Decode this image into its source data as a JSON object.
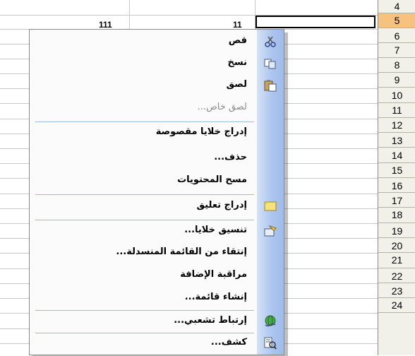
{
  "spreadsheet": {
    "row_numbers": [
      "4",
      "5",
      "6",
      "7",
      "8",
      "9",
      "10",
      "11",
      "12",
      "13",
      "14",
      "15",
      "16",
      "17",
      "18",
      "19",
      "20",
      "21",
      "22",
      "23",
      "24"
    ],
    "active_row": "5",
    "cell_values": [
      "111",
      "11"
    ]
  },
  "context_menu": {
    "items": [
      {
        "label": "قص",
        "enabled": true,
        "icon": "scissors-icon"
      },
      {
        "label": "نسخ",
        "enabled": true,
        "icon": "copy-icon"
      },
      {
        "label": "لصق",
        "enabled": true,
        "icon": "paste-icon"
      },
      {
        "label": "لصق خاص...",
        "enabled": false,
        "icon": ""
      },
      {
        "label": "إدراج خلايا مقصوصة",
        "enabled": true,
        "icon": ""
      },
      {
        "label": "حذف...",
        "enabled": true,
        "icon": ""
      },
      {
        "label": "مسح المحتويات",
        "enabled": true,
        "icon": ""
      },
      {
        "label": "إدراج تعليق",
        "enabled": true,
        "icon": "comment-icon"
      },
      {
        "label": "تنسيق خلايا...",
        "enabled": true,
        "icon": "format-cells-icon"
      },
      {
        "label": "إنتقاء من القائمة المنسدلة...",
        "enabled": true,
        "icon": ""
      },
      {
        "label": "مراقبة الإضافة",
        "enabled": true,
        "icon": ""
      },
      {
        "label": "إنشاء قائمة...",
        "enabled": true,
        "icon": ""
      },
      {
        "label": "إرتباط تشعبي...",
        "enabled": true,
        "icon": "hyperlink-icon"
      },
      {
        "label": "كشف...",
        "enabled": true,
        "icon": "lookup-icon"
      }
    ]
  }
}
